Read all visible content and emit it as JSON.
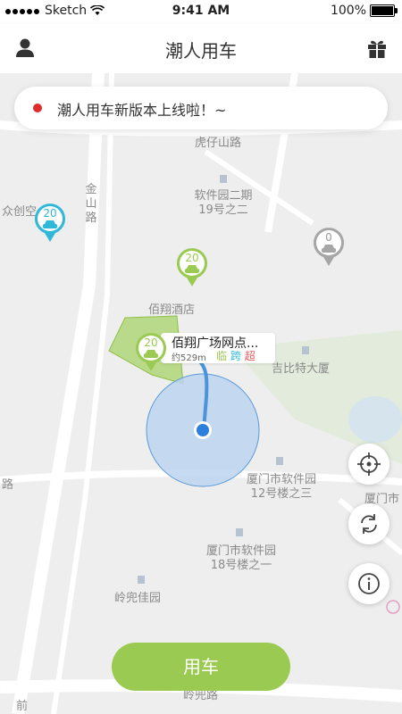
{
  "status_bar": {
    "carrier": "Sketch",
    "time": "9:41 AM",
    "battery": "100%"
  },
  "header": {
    "title": "潮人用车",
    "left_icon": "user-icon",
    "right_icon": "gift-icon"
  },
  "notice": {
    "text": "潮人用车新版本上线啦！~"
  },
  "map": {
    "labels": {
      "huzaishan": "虎仔山路",
      "jinshan": "金山路",
      "software_19_line1": "软件园二期",
      "software_19_line2": "19号之二",
      "zhongchuang": "众创空",
      "baixiang_hotel": "佰翔酒店",
      "jibite": "吉比特大厦",
      "xiamen_12_line1": "厦门市软件园",
      "xiamen_12_line2": "12号楼之三",
      "xiamen_18_line1": "厦门市软件园",
      "xiamen_18_line2": "18号楼之一",
      "lingdou": "岭兜佳园",
      "road_left": "路",
      "road_right": "厦门市",
      "road_bottom_left": "前",
      "road_bottom": "岭兜路"
    },
    "pins": [
      {
        "id": "pin-cyan",
        "count": "20",
        "color": "#2fb8d8"
      },
      {
        "id": "pin-green",
        "count": "20",
        "color": "#9bca52"
      },
      {
        "id": "pin-gray",
        "count": "0",
        "color": "#999999"
      },
      {
        "id": "pin-selected",
        "count": "20",
        "color": "#9bca52"
      }
    ],
    "station": {
      "name": "佰翔广场网点...",
      "distance": "约529m",
      "tags": [
        "临",
        "跨",
        "超"
      ],
      "tag_colors": [
        "#9bca52",
        "#2fb8d8",
        "#e05a5a"
      ]
    }
  },
  "controls": {
    "locate": "crosshair-icon",
    "refresh": "refresh-icon",
    "info": "info-icon"
  },
  "primary_button": {
    "label": "用车"
  },
  "colors": {
    "accent": "#9bca52",
    "location_blue": "#2d7fdc",
    "map_bg": "#eeeeee"
  }
}
